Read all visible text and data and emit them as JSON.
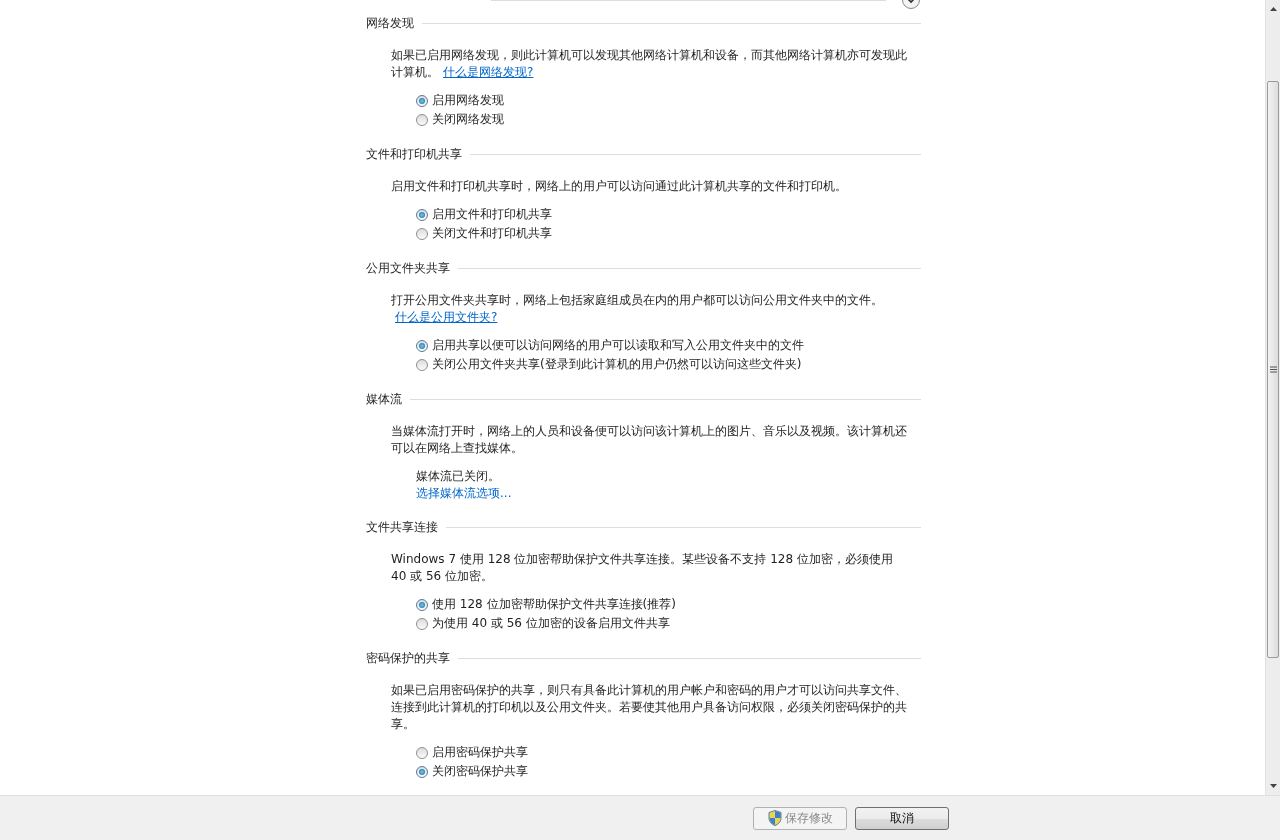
{
  "sections": [
    {
      "heading": "网络发现",
      "kind": "radios",
      "description": "如果已启用网络发现，则此计算机可以发现其他网络计算机和设备，而其他网络计算机亦可发现此计算机。",
      "link": "什么是网络发现?",
      "options": [
        {
          "label": "启用网络发现",
          "selected": true
        },
        {
          "label": "关闭网络发现",
          "selected": false
        }
      ]
    },
    {
      "heading": "文件和打印机共享",
      "kind": "radios",
      "description": "启用文件和打印机共享时，网络上的用户可以访问通过此计算机共享的文件和打印机。",
      "options": [
        {
          "label": "启用文件和打印机共享",
          "selected": true
        },
        {
          "label": "关闭文件和打印机共享",
          "selected": false
        }
      ]
    },
    {
      "heading": "公用文件夹共享",
      "kind": "radios",
      "description": "打开公用文件夹共享时，网络上包括家庭组成员在内的用户都可以访问公用文件夹中的文件。",
      "link": "什么是公用文件夹?",
      "options": [
        {
          "label": "启用共享以便可以访问网络的用户可以读取和写入公用文件夹中的文件",
          "selected": true
        },
        {
          "label": "关闭公用文件夹共享(登录到此计算机的用户仍然可以访问这些文件夹)",
          "selected": false
        }
      ]
    },
    {
      "heading": "媒体流",
      "kind": "status",
      "description": "当媒体流打开时，网络上的人员和设备便可以访问该计算机上的图片、音乐以及视频。该计算机还可以在网络上查找媒体。",
      "status": "媒体流已关闭。",
      "action_link": "选择媒体流选项..."
    },
    {
      "heading": "文件共享连接",
      "kind": "radios",
      "description": "Windows 7 使用 128 位加密帮助保护文件共享连接。某些设备不支持 128 位加密，必须使用 40 或 56 位加密。",
      "options": [
        {
          "label": "使用 128 位加密帮助保护文件共享连接(推荐)",
          "selected": true
        },
        {
          "label": "为使用 40 或 56 位加密的设备启用文件共享",
          "selected": false
        }
      ]
    },
    {
      "heading": "密码保护的共享",
      "kind": "radios",
      "description": "如果已启用密码保护的共享，则只有具备此计算机的用户帐户和密码的用户才可以访问共享文件、连接到此计算机的打印机以及公用文件夹。若要使其他用户具备访问权限，必须关闭密码保护的共享。",
      "options": [
        {
          "label": "启用密码保护共享",
          "selected": false
        },
        {
          "label": "关闭密码保护共享",
          "selected": true
        }
      ]
    }
  ],
  "buttons": [
    {
      "label": "保存修改",
      "disabled": true,
      "shield": true
    },
    {
      "label": "取消",
      "disabled": false,
      "shield": false
    }
  ]
}
